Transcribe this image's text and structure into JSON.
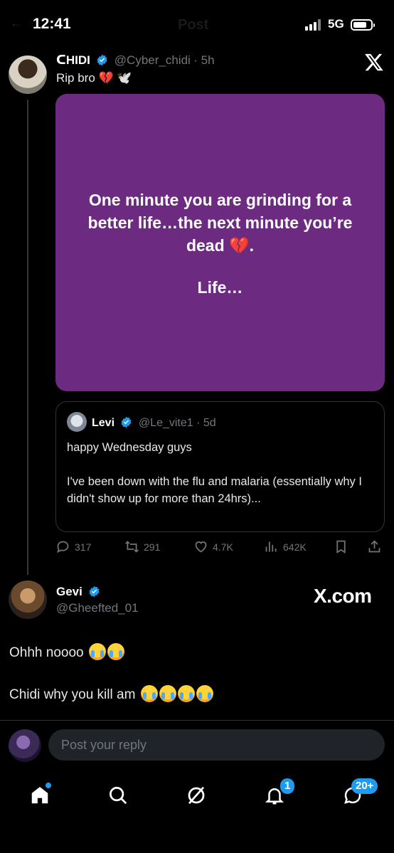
{
  "status_bar": {
    "time": "12:41",
    "network": "5G",
    "header_ghost": "Post"
  },
  "tweet1": {
    "author": "ᑕHIDI",
    "handle": "@Cyber_chidi",
    "time": "5h",
    "text": "Rip bro 💔 🕊️",
    "image_line1": "One minute you are grinding for a better life…the next minute you’re dead 💔.",
    "image_line2": "Life…",
    "quote": {
      "author": "Levi",
      "handle": "@Le_vite1",
      "time": "5d",
      "text": "happy Wednesday guys\n\nI've been down with the flu and malaria (essentially why I didn't show up for more than 24hrs)..."
    },
    "stats": {
      "replies": "317",
      "reposts": "291",
      "likes": "4.7K",
      "views": "642K"
    }
  },
  "tweet2": {
    "author": "Gevi",
    "handle": "@Gheefted_01",
    "watermark": "X.com",
    "line1": "Ohhh  noooo",
    "line2": "Chidi why you kill am"
  },
  "reply": {
    "placeholder": "Post your reply"
  },
  "nav": {
    "notifications_badge": "1",
    "messages_badge": "20+"
  },
  "colors": {
    "accent": "#1d9bf0",
    "card": "#6c2b80",
    "bg": "#000000",
    "muted": "#71767b"
  },
  "icons": [
    "x-logo-icon",
    "verified-icon",
    "reply-icon",
    "repost-icon",
    "like-icon",
    "views-icon",
    "bookmark-icon",
    "share-icon",
    "home-icon",
    "search-icon",
    "grok-icon",
    "bell-icon",
    "messages-icon"
  ]
}
